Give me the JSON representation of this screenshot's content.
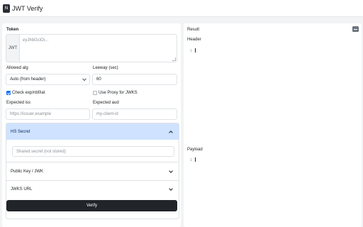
{
  "app": {
    "logo_glyph": "N",
    "title": "JWT Verify"
  },
  "token": {
    "label": "Token",
    "addon": "JWT",
    "placeholder": "eyJhbGciOi..."
  },
  "allowed_alg": {
    "label": "Allowed alg",
    "value": "Auto (from header)"
  },
  "leeway": {
    "label": "Leeway (sec)",
    "value": "60"
  },
  "check_exp": {
    "label": "Check exp/nbf/iat",
    "checked": true
  },
  "use_proxy": {
    "label": "Use Proxy for JWKS",
    "checked": false
  },
  "expected_iss": {
    "label": "Expected iss",
    "placeholder": "https://issuer.example"
  },
  "expected_aud": {
    "label": "Expected aud",
    "placeholder": "my-client-id"
  },
  "accordion": {
    "hs_secret": {
      "title": "HS Secret",
      "expanded": true,
      "placeholder": "Shared secret (not stored)"
    },
    "public_key": {
      "title": "Public Key / JWK",
      "expanded": false
    },
    "jwks_url": {
      "title": "JWKS URL",
      "expanded": false
    }
  },
  "verify_button": {
    "label": "Verify"
  },
  "result": {
    "title": "Result",
    "header_label": "Header",
    "header_line": "1",
    "payload_label": "Payload",
    "payload_line": "1"
  },
  "colors": {
    "accent": "#0d6efd",
    "accordion_active": "#cfe2ff",
    "button_dark": "#212529"
  }
}
